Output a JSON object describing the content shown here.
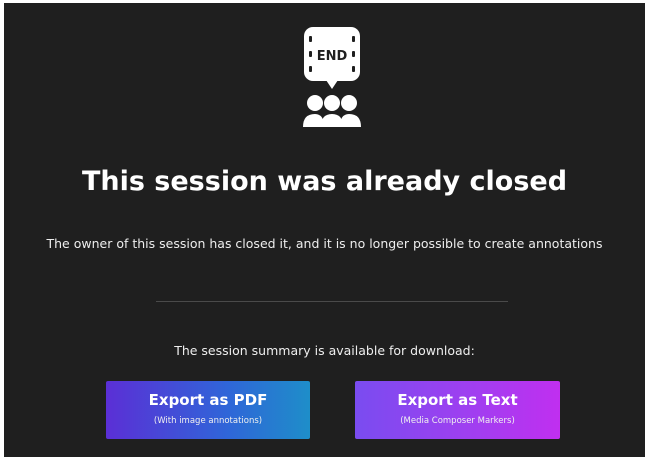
{
  "icon": {
    "name": "session-end-icon",
    "badge_text": "END"
  },
  "main": {
    "title": "This session was already closed",
    "message": "The owner of this session has closed it, and it is no longer possible to create annotations",
    "summary_text": "The session summary is available for download:"
  },
  "buttons": {
    "export_pdf": {
      "label": "Export as PDF",
      "sublabel": "(With image annotations)"
    },
    "export_text": {
      "label": "Export as Text",
      "sublabel": "(Media Composer Markers)"
    }
  },
  "colors": {
    "background": "#1f1f1f",
    "pdf_gradient": [
      "#5b2fd6",
      "#1e8ec9"
    ],
    "text_gradient": [
      "#7a4cf0",
      "#c02ff0"
    ]
  }
}
